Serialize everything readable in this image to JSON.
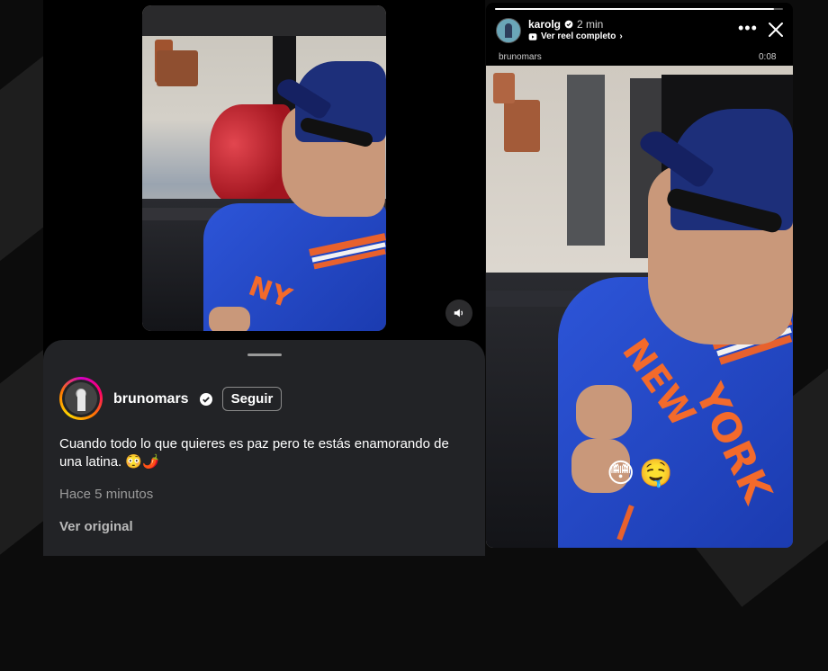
{
  "left_post": {
    "caption_author": "brunomars",
    "follow_label": "Seguir",
    "caption_text": "Cuando todo lo que quieres es paz pero te estás enamorando de una latina. 😳🌶️",
    "timestamp": "Hace 5 minutos",
    "see_original": "Ver original"
  },
  "right_story": {
    "username": "karolg",
    "time_ago": "2 min",
    "reel_link": "Ver reel completo",
    "audio_credit": "brunomars",
    "duration": "0:08",
    "progress": 0.97,
    "stickers": [
      "😳",
      "🤤"
    ]
  },
  "icons": [
    "sound-icon",
    "verified-icon",
    "more-options-icon",
    "close-icon",
    "reel-icon",
    "chevron-right-icon"
  ],
  "colors": {
    "sheet_bg": "#222326",
    "jacket_blue": "#2a4fd0",
    "jacket_orange": "#f36a2b",
    "story_ring": "#ff0069"
  }
}
